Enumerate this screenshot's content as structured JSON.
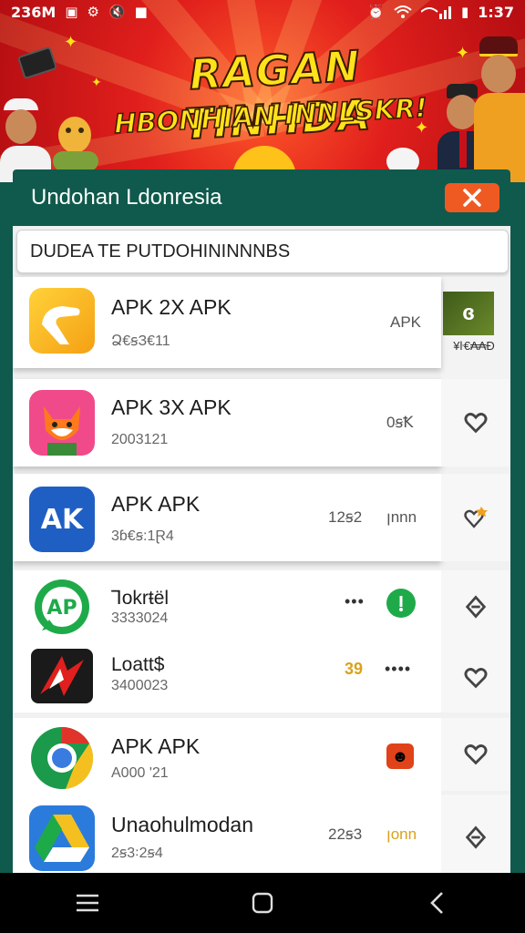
{
  "status": {
    "carrier": "236M",
    "time": "1:37",
    "icons": [
      "gallery-icon",
      "settings-icon",
      "mute-icon",
      "notification-icon",
      "alarm-icon",
      "wifi-icon",
      "signal-icon",
      "battery-icon"
    ]
  },
  "banner": {
    "title": "RAGAN TINHDA",
    "subtitle": "HBONHIAN INNLSKR!"
  },
  "dialog": {
    "title": "Undohan Ldonresia",
    "close_icon": "close-icon"
  },
  "search": {
    "value": "DUDEA TE PUTDOHININNNBS"
  },
  "apps": [
    {
      "name": "APK 2X APK",
      "meta": "Ձ€ꞩЗ€11",
      "side": "APK",
      "icon": "hand-pointer-icon",
      "rail_icon": "app-thumbnail-icon",
      "rail_text": "¥ŀ€₳₳Ð"
    },
    {
      "name": "APK 3X APK",
      "meta": "2003121",
      "side": "0ꞩꝀ",
      "icon": "fox-icon",
      "rail_icon": "heart-icon"
    },
    {
      "name": "APK APK",
      "meta": "3ɓ€ꞩ:1Ɽ4",
      "side": "12ꞩ2",
      "side2": "ꞁnnn",
      "icon": "ak-logo-icon",
      "rail_icon": "heart-badge-icon"
    },
    {
      "name": "Ꞁokrŧël",
      "meta": "3333024",
      "side": "•••",
      "icon": "ap-chat-icon",
      "rail_icon": "diamond-icon",
      "action_icon": "download-icon"
    },
    {
      "name": "Loatt$",
      "meta": "3400023",
      "side": "39",
      "side2": "••••",
      "icon": "red-logo-icon",
      "rail_icon": "heart-icon"
    },
    {
      "name": "APK APK",
      "meta": "A000 '21",
      "icon": "chrome-icon",
      "rail_icon": "heart-icon",
      "action_icon": "emoji-icon"
    },
    {
      "name": "Unaohulmodan",
      "meta": "2ꞩ3꞉2ꞩ4",
      "side": "22ꞩ3",
      "side2": "ꞁonn",
      "icon": "drive-icon",
      "rail_icon": "diamond-icon"
    }
  ],
  "colors": {
    "brand_green": "#0f5a4c",
    "banner_red": "#c8101b",
    "accent_orange": "#ef5a23",
    "title_yellow": "#ffe21a"
  },
  "nav": {
    "icons": [
      "menu-icon",
      "home-icon",
      "back-icon"
    ]
  }
}
